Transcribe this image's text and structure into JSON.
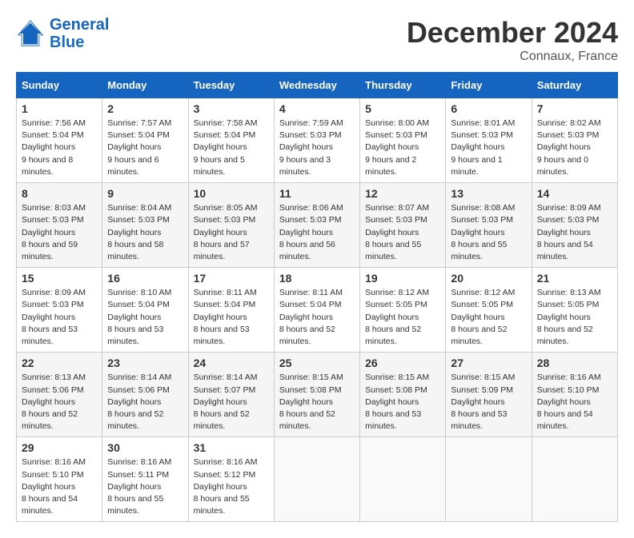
{
  "header": {
    "logo_line1": "General",
    "logo_line2": "Blue",
    "month": "December 2024",
    "location": "Connaux, France"
  },
  "days_of_week": [
    "Sunday",
    "Monday",
    "Tuesday",
    "Wednesday",
    "Thursday",
    "Friday",
    "Saturday"
  ],
  "weeks": [
    [
      {
        "day": "1",
        "sunrise": "7:56 AM",
        "sunset": "5:04 PM",
        "daylight": "9 hours and 8 minutes."
      },
      {
        "day": "2",
        "sunrise": "7:57 AM",
        "sunset": "5:04 PM",
        "daylight": "9 hours and 6 minutes."
      },
      {
        "day": "3",
        "sunrise": "7:58 AM",
        "sunset": "5:04 PM",
        "daylight": "9 hours and 5 minutes."
      },
      {
        "day": "4",
        "sunrise": "7:59 AM",
        "sunset": "5:03 PM",
        "daylight": "9 hours and 3 minutes."
      },
      {
        "day": "5",
        "sunrise": "8:00 AM",
        "sunset": "5:03 PM",
        "daylight": "9 hours and 2 minutes."
      },
      {
        "day": "6",
        "sunrise": "8:01 AM",
        "sunset": "5:03 PM",
        "daylight": "9 hours and 1 minute."
      },
      {
        "day": "7",
        "sunrise": "8:02 AM",
        "sunset": "5:03 PM",
        "daylight": "9 hours and 0 minutes."
      }
    ],
    [
      {
        "day": "8",
        "sunrise": "8:03 AM",
        "sunset": "5:03 PM",
        "daylight": "8 hours and 59 minutes."
      },
      {
        "day": "9",
        "sunrise": "8:04 AM",
        "sunset": "5:03 PM",
        "daylight": "8 hours and 58 minutes."
      },
      {
        "day": "10",
        "sunrise": "8:05 AM",
        "sunset": "5:03 PM",
        "daylight": "8 hours and 57 minutes."
      },
      {
        "day": "11",
        "sunrise": "8:06 AM",
        "sunset": "5:03 PM",
        "daylight": "8 hours and 56 minutes."
      },
      {
        "day": "12",
        "sunrise": "8:07 AM",
        "sunset": "5:03 PM",
        "daylight": "8 hours and 55 minutes."
      },
      {
        "day": "13",
        "sunrise": "8:08 AM",
        "sunset": "5:03 PM",
        "daylight": "8 hours and 55 minutes."
      },
      {
        "day": "14",
        "sunrise": "8:09 AM",
        "sunset": "5:03 PM",
        "daylight": "8 hours and 54 minutes."
      }
    ],
    [
      {
        "day": "15",
        "sunrise": "8:09 AM",
        "sunset": "5:03 PM",
        "daylight": "8 hours and 53 minutes."
      },
      {
        "day": "16",
        "sunrise": "8:10 AM",
        "sunset": "5:04 PM",
        "daylight": "8 hours and 53 minutes."
      },
      {
        "day": "17",
        "sunrise": "8:11 AM",
        "sunset": "5:04 PM",
        "daylight": "8 hours and 53 minutes."
      },
      {
        "day": "18",
        "sunrise": "8:11 AM",
        "sunset": "5:04 PM",
        "daylight": "8 hours and 52 minutes."
      },
      {
        "day": "19",
        "sunrise": "8:12 AM",
        "sunset": "5:05 PM",
        "daylight": "8 hours and 52 minutes."
      },
      {
        "day": "20",
        "sunrise": "8:12 AM",
        "sunset": "5:05 PM",
        "daylight": "8 hours and 52 minutes."
      },
      {
        "day": "21",
        "sunrise": "8:13 AM",
        "sunset": "5:05 PM",
        "daylight": "8 hours and 52 minutes."
      }
    ],
    [
      {
        "day": "22",
        "sunrise": "8:13 AM",
        "sunset": "5:06 PM",
        "daylight": "8 hours and 52 minutes."
      },
      {
        "day": "23",
        "sunrise": "8:14 AM",
        "sunset": "5:06 PM",
        "daylight": "8 hours and 52 minutes."
      },
      {
        "day": "24",
        "sunrise": "8:14 AM",
        "sunset": "5:07 PM",
        "daylight": "8 hours and 52 minutes."
      },
      {
        "day": "25",
        "sunrise": "8:15 AM",
        "sunset": "5:08 PM",
        "daylight": "8 hours and 52 minutes."
      },
      {
        "day": "26",
        "sunrise": "8:15 AM",
        "sunset": "5:08 PM",
        "daylight": "8 hours and 53 minutes."
      },
      {
        "day": "27",
        "sunrise": "8:15 AM",
        "sunset": "5:09 PM",
        "daylight": "8 hours and 53 minutes."
      },
      {
        "day": "28",
        "sunrise": "8:16 AM",
        "sunset": "5:10 PM",
        "daylight": "8 hours and 54 minutes."
      }
    ],
    [
      {
        "day": "29",
        "sunrise": "8:16 AM",
        "sunset": "5:10 PM",
        "daylight": "8 hours and 54 minutes."
      },
      {
        "day": "30",
        "sunrise": "8:16 AM",
        "sunset": "5:11 PM",
        "daylight": "8 hours and 55 minutes."
      },
      {
        "day": "31",
        "sunrise": "8:16 AM",
        "sunset": "5:12 PM",
        "daylight": "8 hours and 55 minutes."
      },
      null,
      null,
      null,
      null
    ]
  ]
}
